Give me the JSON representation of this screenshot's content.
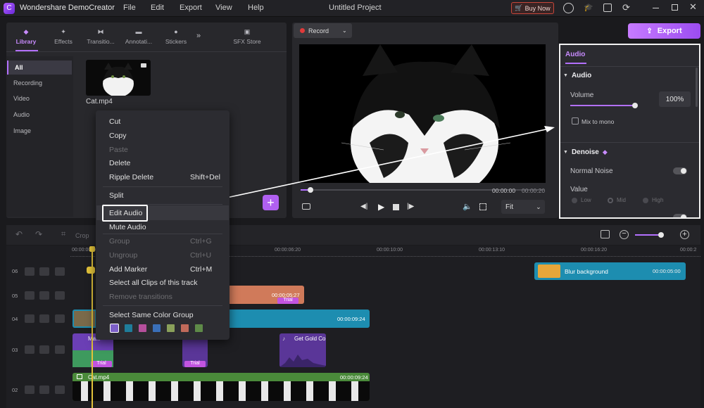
{
  "app": {
    "title": "Wondershare DemoCreator",
    "project": "Untitled Project"
  },
  "menu": [
    "File",
    "Edit",
    "Export",
    "View",
    "Help"
  ],
  "buy_now": "Buy Now",
  "library_tabs": [
    {
      "label": "Library",
      "icon": "layers-icon"
    },
    {
      "label": "Effects",
      "icon": "effects-icon"
    },
    {
      "label": "Transitio...",
      "icon": "transition-icon"
    },
    {
      "label": "Annotati...",
      "icon": "annotation-icon"
    },
    {
      "label": "Stickers",
      "icon": "sticker-icon"
    }
  ],
  "sfx_store": "SFX Store",
  "sidebar": [
    "All",
    "Recording",
    "Video",
    "Audio",
    "Image"
  ],
  "media": {
    "name": "Cat.mp4"
  },
  "record_label": "Record",
  "export_label": "Export",
  "context_menu": {
    "items": [
      {
        "label": "Cut",
        "enabled": true
      },
      {
        "label": "Copy",
        "enabled": true
      },
      {
        "label": "Paste",
        "enabled": false
      },
      {
        "label": "Delete",
        "enabled": true
      },
      {
        "label": "Ripple Delete",
        "shortcut": "Shift+Del",
        "enabled": true
      },
      {
        "label": "Split",
        "enabled": true
      },
      {
        "label": "Edit Audio",
        "enabled": true,
        "highlighted": true
      },
      {
        "label": "Mute Audio",
        "enabled": true
      },
      {
        "label": "Group",
        "shortcut": "Ctrl+G",
        "enabled": false
      },
      {
        "label": "Ungroup",
        "shortcut": "Ctrl+U",
        "enabled": false
      },
      {
        "label": "Add Marker",
        "shortcut": "Ctrl+M",
        "enabled": true
      },
      {
        "label": "Select all Clips of this track",
        "enabled": true
      },
      {
        "label": "Remove transitions",
        "enabled": false
      },
      {
        "label": "Select Same Color Group",
        "enabled": true
      }
    ],
    "swatches": [
      "#7c5fc7",
      "#1f7d9a",
      "#b54f9c",
      "#3a6fb8",
      "#8aa05a",
      "#c06a5a",
      "#5e8a48"
    ]
  },
  "preview": {
    "time_current": "00:00:00",
    "time_total": "00:00:20",
    "fit": "Fit"
  },
  "properties": {
    "tab": "Audio",
    "audio_section": "Audio",
    "volume_label": "Volume",
    "volume_value": "100%",
    "volume_level": 1.0,
    "mix_to_mono": "Mix to mono",
    "denoise_section": "Denoise",
    "normal_noise": "Normal Noise",
    "value_label": "Value",
    "levels": [
      "Low",
      "Mid",
      "High"
    ]
  },
  "timeline": {
    "crop_label": "Crop",
    "ruler": [
      "00:00:00:00",
      "00:00:06:20",
      "00:00:10:00",
      "00:00:13:10",
      "00:00:16:20",
      "00:00:2"
    ],
    "track_numbers": [
      "06",
      "05",
      "04",
      "03",
      "02"
    ],
    "clips": {
      "blur": {
        "label": "Blur background",
        "time": "00:00:05:00"
      },
      "c05": {
        "time": "00:00:05:27",
        "badge": "Trial"
      },
      "c04": {
        "time": "00:00:09:24"
      },
      "m1": {
        "label": "Ma...",
        "badge": "Trial"
      },
      "m2": {
        "badge": "Trial"
      },
      "gold": {
        "label": "Get Gold Co"
      },
      "cat": {
        "label": "Cat.mp4",
        "time": "00:00:09:24"
      }
    }
  }
}
